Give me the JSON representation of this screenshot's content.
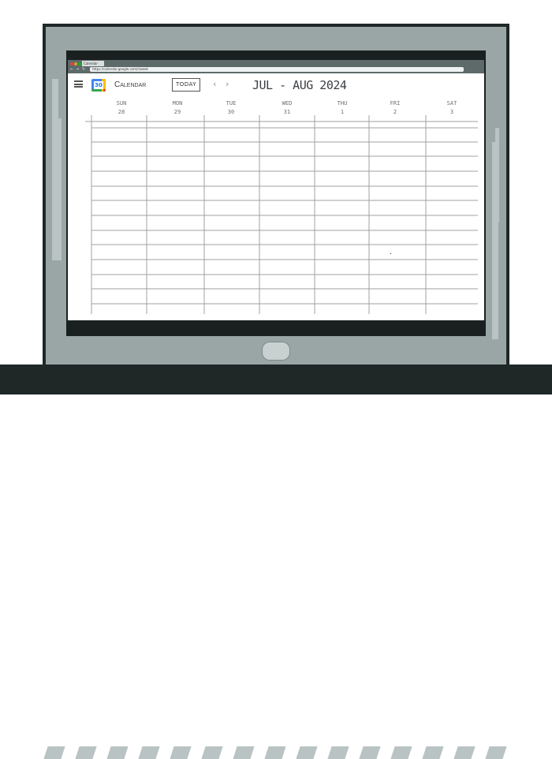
{
  "browser": {
    "tab_title": "Calendar",
    "address": "https://calendar.google.com/r/week"
  },
  "header": {
    "app_title": "Calendar",
    "logo_text": "30",
    "today_label": "TODAY",
    "prev_icon": "chevron-left-icon",
    "next_icon": "chevron-right-icon",
    "date_range": "JUL - AUG 2024"
  },
  "week": {
    "days": [
      {
        "name": "SUN",
        "num": "28"
      },
      {
        "name": "MON",
        "num": "29"
      },
      {
        "name": "TUE",
        "num": "30"
      },
      {
        "name": "WED",
        "num": "31"
      },
      {
        "name": "THU",
        "num": "1"
      },
      {
        "name": "FRI",
        "num": "2"
      },
      {
        "name": "SAT",
        "num": "3"
      }
    ]
  },
  "colors": {
    "laptop_body": "#9aa6a6",
    "laptop_outline": "#1f2727",
    "bezel": "#1a2020",
    "grid_line": "#a0a0a0",
    "logo_blue": "#4285f4"
  }
}
